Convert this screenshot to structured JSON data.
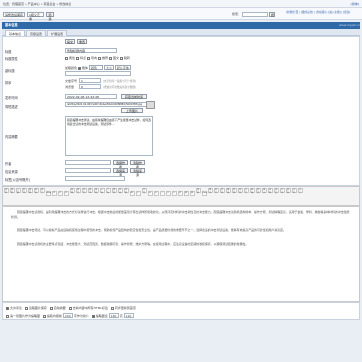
{
  "header": {
    "breadcrumb": "位置：管理首页 » 产品中心 » 项目后台 » 修改信息",
    "top_right": "[简体]"
  },
  "toolbar": {
    "select1": "请修改后保存",
    "select2": "1级父元素",
    "filter_btn": "筛选",
    "search_label": "搜索：",
    "search_btn": "搜",
    "links": "[新增]栏目 | [我的后台] | [到标题] | [进入主题] | [更多]"
  },
  "panel": {
    "title": "基本信息",
    "watermark": "www.mypb.cn"
  },
  "tabs": [
    "基本信息",
    "高级设置",
    "扩展设置"
  ],
  "form": {
    "top_btn1": "提交",
    "top_btn2": "重置",
    "labels": {
      "title": "标题",
      "title_attr": "标题属性",
      "extra": "副标题",
      "sort": "排序",
      "date": "发布时间",
      "ad": "简短描述",
      "content": "内容摘要",
      "author": "作者",
      "source": "信息来源",
      "keywords": "标签[以逗号隔开]"
    },
    "title_value": "暂缺标题内容",
    "title_opts": [
      "属性",
      "特点",
      "导向",
      "推荐",
      "图文",
      "跳转"
    ],
    "extra_opts_label": "加粗颜色",
    "extra_check": "粗体",
    "extra_select": "颜色",
    "extra_select2": "大小",
    "extra_font": "默认字体",
    "sort_label": "文章序号",
    "sort_value": "1",
    "sort_hint": "(文字排序一般按“序号”排列)",
    "views_label": "浏览量",
    "views_value": "0",
    "views_hint": "(增加访问次数后的显示数值)",
    "date_value": "2022-02-06 12:44:48",
    "date_btn": "获取当前时间",
    "ad_value": "/a0/0/p/2022-02-06/7ed67c4bbed5b4c6d9f9889c56023f08.jpg",
    "ad_btn": "上传图片",
    "content_value": "圆弧摆锤冲击测试，由铁球摆锤自由落下产生能量冲击试样，如何选用最合适的冲击测试设备，测试部件…",
    "author_btn1": "选择作者",
    "author_btn2": "清除作者",
    "source_btn1": "选择来源",
    "source_btn2": "清除来源"
  },
  "editor": {
    "toolbar_icons": [
      "源码",
      "撤销",
      "重做",
      "剪切",
      "复制",
      "粘贴",
      "纯文",
      "Word",
      "左",
      "中",
      "右",
      "两端",
      "编号",
      "项目",
      "缩进",
      "减缩",
      "上标",
      "下标",
      "清除",
      "全选",
      "全屏",
      "H1",
      "F",
      "字号",
      "A",
      "B",
      "I",
      "U",
      "S",
      "表",
      "图",
      "图",
      "视频",
      "Flash",
      "媒体",
      "附件",
      "表格",
      "横线",
      "表情",
      "特殊",
      "分页",
      "链接",
      "取消",
      "锚点",
      "地图",
      "预览",
      "打印",
      "模板",
      "代码",
      "关于"
    ],
    "paragraphs": [
      "圆弧摆锤冲击试验机，是利用摆锤冲击的方式对试样进行冲击，根据冲击前后的能量差值计算出试样所吸收的功，从而评定材料的冲击韧性及抗冲击能力。圆弧摆锤冲击试验机结构简单、操作方便、测试精确度高，适用于金属、塑料、橡胶等多种材料的冲击性能检测。",
      "圆弧摆锤冲击测试，可以模拟产品在运输和使用过程中受到的冲击，帮助检测产品结构的稳定性和安全性，是产品质量检测的重要环节之一。选择合适的冲击测试设备，能够有效提高产品的可靠性和用户满意度。",
      "圆弧摆锤冲击试验机的主要特点包括：冲击能量大、测试范围宽、数据准确可靠、操作简便、维护方便等。在使用过程中，应注意设备的定期校准和保养，以确保测试结果的准确性。"
    ]
  },
  "bottom": {
    "row1": [
      "允许评论",
      "远程图片保存",
      "自动摘要",
      "去掉内容中所有HTML标签",
      "同步更新到首页"
    ],
    "row2_a": "第一张图片作为缩略图",
    "row2_b": "提取内容前",
    "row2_c": "字作为简介",
    "row2_num": "200",
    "row2_d": "缩略图宽",
    "row2_w": "160",
    "row2_e": "高",
    "row2_h": "120"
  }
}
